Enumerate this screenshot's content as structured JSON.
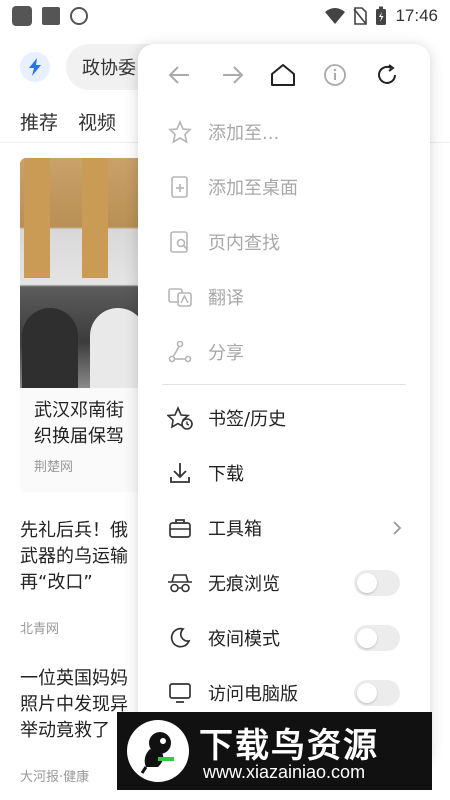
{
  "status_bar": {
    "time": "17:46"
  },
  "background": {
    "search_text": "政协委",
    "tabs": [
      "推荐",
      "视频"
    ],
    "card": {
      "title_line1": "武汉邓南街",
      "title_line2": "织换届保驾",
      "source": "荆楚网"
    },
    "news": [
      {
        "lines": [
          "先礼后兵！俄",
          "武器的乌运输",
          "再“改口”"
        ],
        "source": "北青网"
      },
      {
        "lines": [
          "一位英国妈妈",
          "照片中发现异",
          "举动竟救了"
        ],
        "source": "大河报·健康"
      }
    ]
  },
  "menu": {
    "nav_icons": [
      "back-arrow-icon",
      "forward-arrow-icon",
      "home-icon",
      "info-icon",
      "refresh-icon"
    ],
    "items": [
      {
        "label": "添加至...",
        "icon": "star-add-icon",
        "enabled": false
      },
      {
        "label": "添加至桌面",
        "icon": "add-to-desktop-icon",
        "enabled": false
      },
      {
        "label": "页内查找",
        "icon": "find-in-page-icon",
        "enabled": false
      },
      {
        "label": "翻译",
        "icon": "translate-icon",
        "enabled": false
      },
      {
        "label": "分享",
        "icon": "share-icon",
        "enabled": false
      },
      {
        "label": "书签/历史",
        "icon": "bookmark-history-icon",
        "enabled": true
      },
      {
        "label": "下载",
        "icon": "download-icon",
        "enabled": true
      },
      {
        "label": "工具箱",
        "icon": "toolbox-icon",
        "enabled": true,
        "has_submenu": true
      },
      {
        "label": "无痕浏览",
        "icon": "incognito-icon",
        "enabled": true,
        "toggle": false
      },
      {
        "label": "夜间模式",
        "icon": "moon-icon",
        "enabled": true,
        "toggle": false
      },
      {
        "label": "访问电脑版",
        "icon": "desktop-icon",
        "enabled": true,
        "toggle": false
      }
    ]
  },
  "watermark": {
    "title": "下载鸟资源",
    "url": "www.xiazainiao.com"
  },
  "colors": {
    "disabled_text": "#a8a8a8",
    "enabled_text": "#222222",
    "toggle_off": "#ececec",
    "banner_bg": "#111111"
  }
}
